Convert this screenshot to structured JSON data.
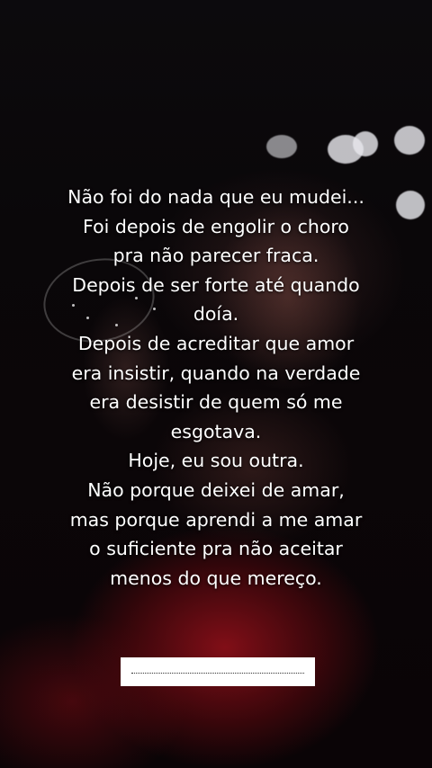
{
  "caption": {
    "lines": [
      "Não foi do nada que eu mudei...",
      "Foi depois de engolir o choro",
      "pra não parecer fraca.",
      "Depois de ser forte até quando",
      "doía.",
      "Depois de acreditar que amor",
      "era insistir, quando na verdade",
      "era desistir de quem só me",
      "esgotava.",
      "Hoje, eu sou outra.",
      "Não porque deixei de amar,",
      "mas porque aprendi a me amar",
      "o suficiente pra não aceitar",
      "menos do que mereço."
    ],
    "color": "#ffffff"
  },
  "background": {
    "description_colors": {
      "dress": "#96101a",
      "base": "#0a0709"
    }
  }
}
